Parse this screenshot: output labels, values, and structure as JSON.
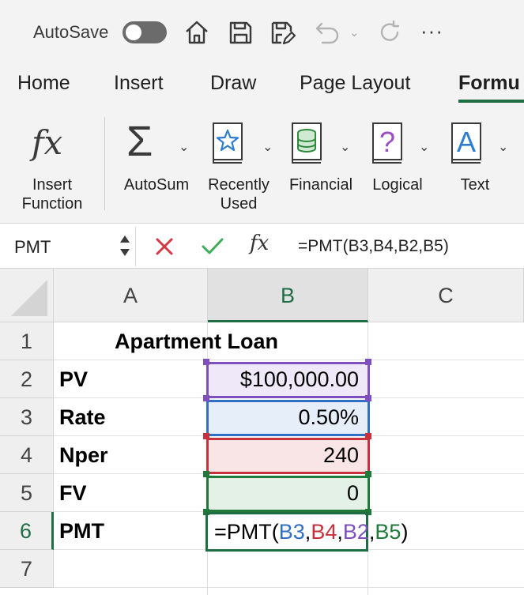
{
  "titlebar": {
    "autosave_label": "AutoSave",
    "autosave_on": false,
    "icons": [
      "home-icon",
      "save-icon",
      "save-as-icon",
      "undo-icon",
      "redo-icon",
      "more-icon"
    ],
    "more_label": "···"
  },
  "tabs": [
    {
      "label": "Home",
      "active": false
    },
    {
      "label": "Insert",
      "active": false
    },
    {
      "label": "Draw",
      "active": false
    },
    {
      "label": "Page Layout",
      "active": false
    },
    {
      "label": "Formu",
      "active": true
    }
  ],
  "ribbon": {
    "insert_function": {
      "line1": "Insert",
      "line2": "Function",
      "icon": "fx-icon",
      "glyph": "fx"
    },
    "autosum": {
      "label": "AutoSum",
      "icon": "sigma-icon",
      "glyph": "Σ"
    },
    "recently_used": {
      "line1": "Recently",
      "line2": "Used",
      "icon": "star-book-icon"
    },
    "financial": {
      "label": "Financial",
      "icon": "coins-book-icon"
    },
    "logical": {
      "label": "Logical",
      "icon": "question-book-icon",
      "glyph": "?"
    },
    "text": {
      "label": "Text",
      "icon": "letter-a-book-icon",
      "glyph": "A"
    },
    "caret": "⌄"
  },
  "formula_bar": {
    "name_box": "PMT",
    "fx_glyph": "fx",
    "formula": "=PMT(B3,B4,B2,B5)"
  },
  "grid": {
    "columns": [
      {
        "label": "A",
        "selected": false
      },
      {
        "label": "B",
        "selected": true
      },
      {
        "label": "C",
        "selected": false
      }
    ],
    "rows": [
      {
        "label": "1",
        "selected": false
      },
      {
        "label": "2",
        "selected": false
      },
      {
        "label": "3",
        "selected": false
      },
      {
        "label": "4",
        "selected": false
      },
      {
        "label": "5",
        "selected": false
      },
      {
        "label": "6",
        "selected": true
      },
      {
        "label": "7",
        "selected": false
      }
    ],
    "title": "Apartment Loan",
    "labels": {
      "r2": "PV",
      "r3": "Rate",
      "r4": "Nper",
      "r5": "FV",
      "r6": "PMT"
    },
    "values": {
      "b2": "$100,000.00",
      "b3": "0.50%",
      "b4": "240",
      "b5": "0"
    },
    "active_formula": {
      "prefix": "=PMT(",
      "ref1": "B3",
      "sep1": ",",
      "ref2": "B4",
      "sep2": ",",
      "ref3": "B2",
      "sep3": ",",
      "ref4": "B5",
      "suffix": ")"
    }
  },
  "colors": {
    "accent": "#1f6e43",
    "ref_b2": "#7d4fbf",
    "ref_b3": "#2f6fc6",
    "ref_b4": "#c8303b",
    "ref_b5": "#1f7a3a"
  }
}
